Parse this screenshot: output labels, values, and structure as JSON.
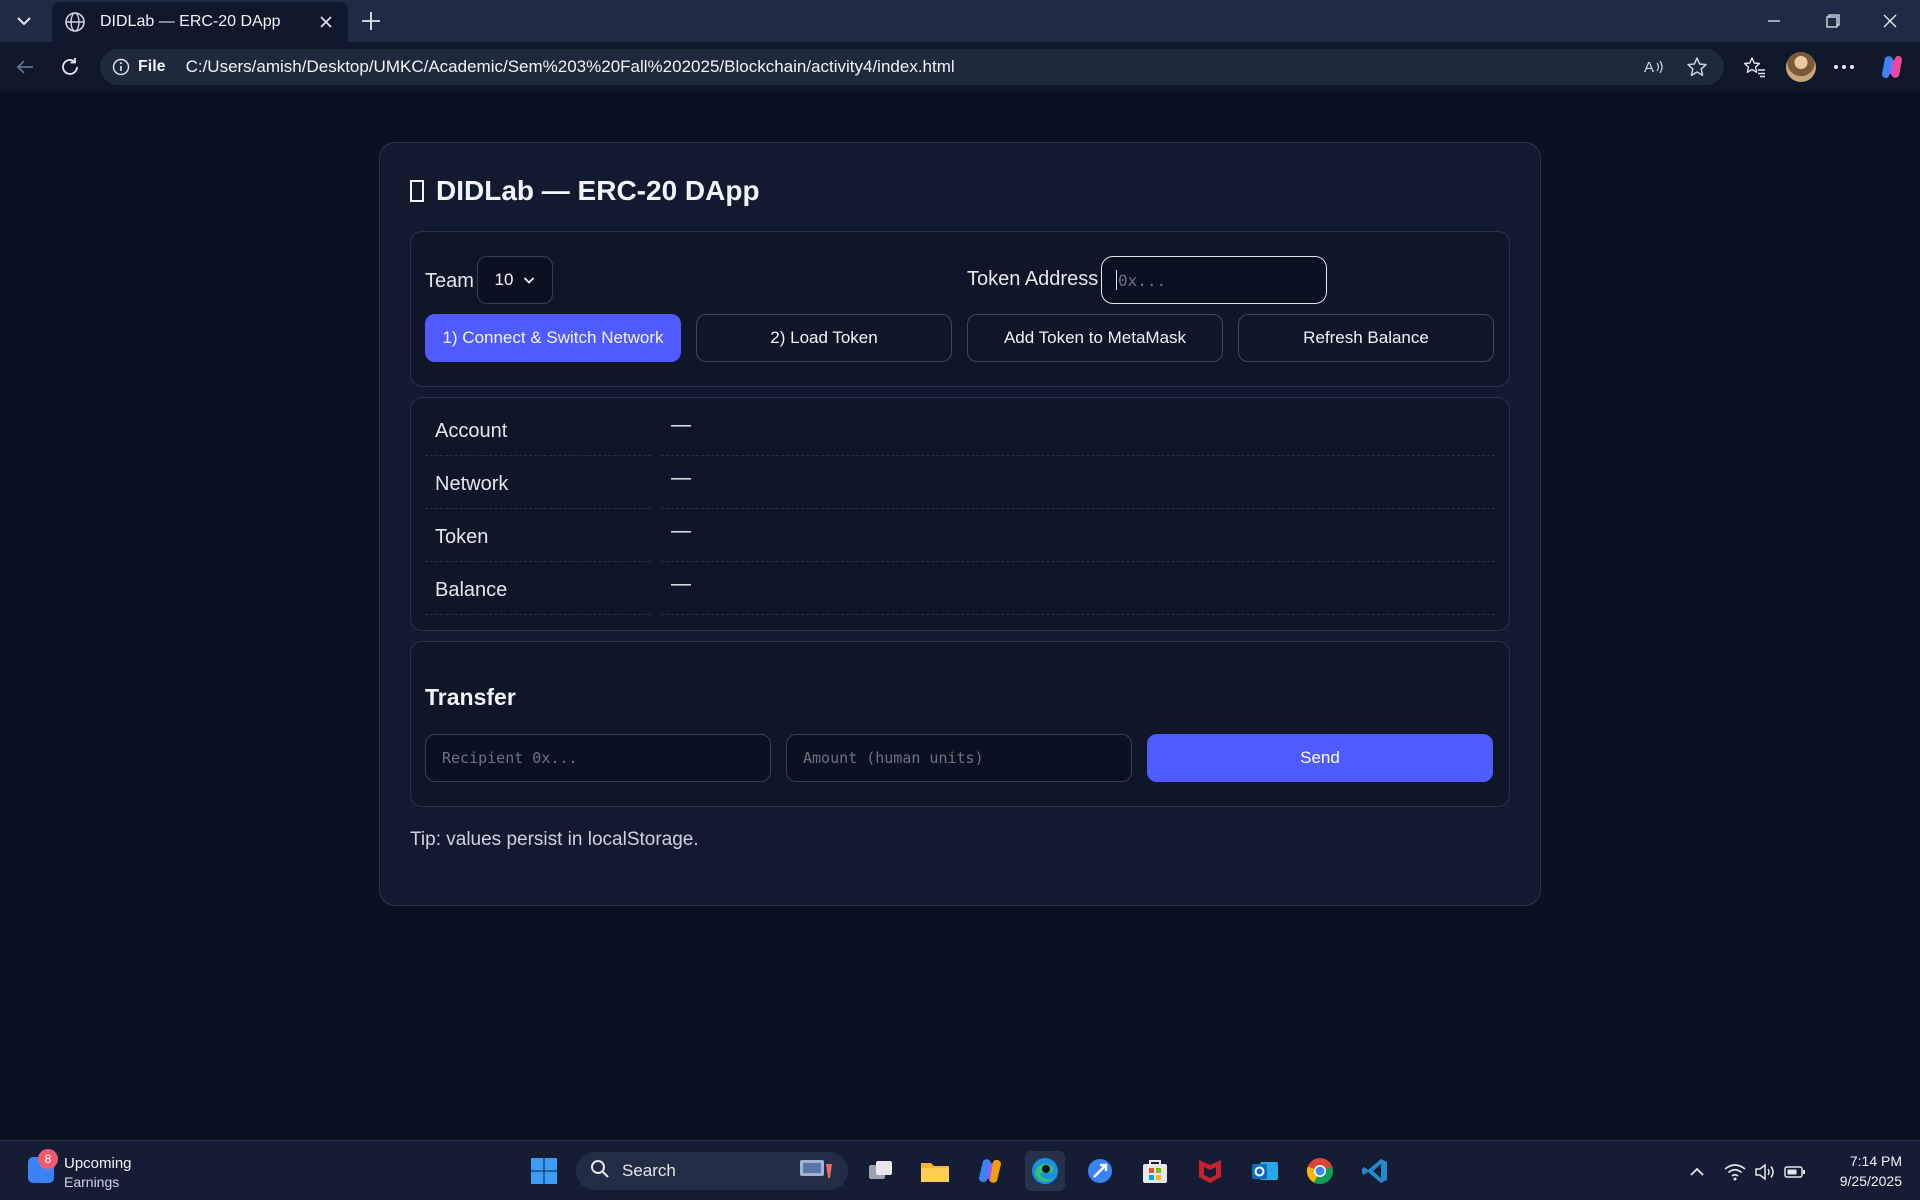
{
  "browser": {
    "tab_title": "DIDLab — ERC-20 DApp",
    "scheme_label": "File",
    "url": "C:/Users/amish/Desktop/UMKC/Academic/Sem%203%20Fall%202025/Blockchain/activity4/index.html"
  },
  "page": {
    "title": "DIDLab — ERC-20 DApp",
    "controls": {
      "team_label": "Team",
      "team_value": "10",
      "token_address_label": "Token Address",
      "token_address_placeholder": "0x...",
      "buttons": {
        "connect": "1) Connect & Switch Network",
        "load_token": "2) Load Token",
        "add_token": "Add Token to MetaMask",
        "refresh": "Refresh Balance"
      }
    },
    "info": {
      "rows": [
        {
          "label": "Account",
          "value": "—"
        },
        {
          "label": "Network",
          "value": "—"
        },
        {
          "label": "Token",
          "value": "—"
        },
        {
          "label": "Balance",
          "value": "—"
        }
      ]
    },
    "transfer": {
      "title": "Transfer",
      "recipient_placeholder": "Recipient 0x...",
      "amount_placeholder": "Amount (human units)",
      "send_label": "Send"
    },
    "tip": "Tip: values persist in localStorage."
  },
  "taskbar": {
    "widget_badge": "8",
    "widget_title": "Upcoming",
    "widget_subtitle": "Earnings",
    "search_label": "Search",
    "time": "7:14 PM",
    "date": "9/25/2025"
  },
  "colors": {
    "accent": "#4f5bff",
    "page_bg": "#0b1120",
    "card_bg": "#111a2e"
  }
}
